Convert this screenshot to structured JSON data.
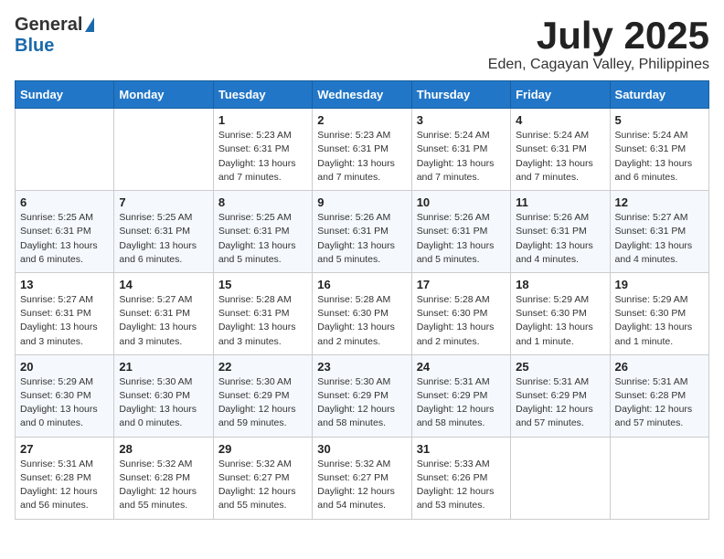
{
  "logo": {
    "general": "General",
    "blue": "Blue"
  },
  "title": "July 2025",
  "location": "Eden, Cagayan Valley, Philippines",
  "days_of_week": [
    "Sunday",
    "Monday",
    "Tuesday",
    "Wednesday",
    "Thursday",
    "Friday",
    "Saturday"
  ],
  "weeks": [
    [
      {
        "num": "",
        "content": ""
      },
      {
        "num": "",
        "content": ""
      },
      {
        "num": "1",
        "content": "Sunrise: 5:23 AM\nSunset: 6:31 PM\nDaylight: 13 hours and 7 minutes."
      },
      {
        "num": "2",
        "content": "Sunrise: 5:23 AM\nSunset: 6:31 PM\nDaylight: 13 hours and 7 minutes."
      },
      {
        "num": "3",
        "content": "Sunrise: 5:24 AM\nSunset: 6:31 PM\nDaylight: 13 hours and 7 minutes."
      },
      {
        "num": "4",
        "content": "Sunrise: 5:24 AM\nSunset: 6:31 PM\nDaylight: 13 hours and 7 minutes."
      },
      {
        "num": "5",
        "content": "Sunrise: 5:24 AM\nSunset: 6:31 PM\nDaylight: 13 hours and 6 minutes."
      }
    ],
    [
      {
        "num": "6",
        "content": "Sunrise: 5:25 AM\nSunset: 6:31 PM\nDaylight: 13 hours and 6 minutes."
      },
      {
        "num": "7",
        "content": "Sunrise: 5:25 AM\nSunset: 6:31 PM\nDaylight: 13 hours and 6 minutes."
      },
      {
        "num": "8",
        "content": "Sunrise: 5:25 AM\nSunset: 6:31 PM\nDaylight: 13 hours and 5 minutes."
      },
      {
        "num": "9",
        "content": "Sunrise: 5:26 AM\nSunset: 6:31 PM\nDaylight: 13 hours and 5 minutes."
      },
      {
        "num": "10",
        "content": "Sunrise: 5:26 AM\nSunset: 6:31 PM\nDaylight: 13 hours and 5 minutes."
      },
      {
        "num": "11",
        "content": "Sunrise: 5:26 AM\nSunset: 6:31 PM\nDaylight: 13 hours and 4 minutes."
      },
      {
        "num": "12",
        "content": "Sunrise: 5:27 AM\nSunset: 6:31 PM\nDaylight: 13 hours and 4 minutes."
      }
    ],
    [
      {
        "num": "13",
        "content": "Sunrise: 5:27 AM\nSunset: 6:31 PM\nDaylight: 13 hours and 3 minutes."
      },
      {
        "num": "14",
        "content": "Sunrise: 5:27 AM\nSunset: 6:31 PM\nDaylight: 13 hours and 3 minutes."
      },
      {
        "num": "15",
        "content": "Sunrise: 5:28 AM\nSunset: 6:31 PM\nDaylight: 13 hours and 3 minutes."
      },
      {
        "num": "16",
        "content": "Sunrise: 5:28 AM\nSunset: 6:30 PM\nDaylight: 13 hours and 2 minutes."
      },
      {
        "num": "17",
        "content": "Sunrise: 5:28 AM\nSunset: 6:30 PM\nDaylight: 13 hours and 2 minutes."
      },
      {
        "num": "18",
        "content": "Sunrise: 5:29 AM\nSunset: 6:30 PM\nDaylight: 13 hours and 1 minute."
      },
      {
        "num": "19",
        "content": "Sunrise: 5:29 AM\nSunset: 6:30 PM\nDaylight: 13 hours and 1 minute."
      }
    ],
    [
      {
        "num": "20",
        "content": "Sunrise: 5:29 AM\nSunset: 6:30 PM\nDaylight: 13 hours and 0 minutes."
      },
      {
        "num": "21",
        "content": "Sunrise: 5:30 AM\nSunset: 6:30 PM\nDaylight: 13 hours and 0 minutes."
      },
      {
        "num": "22",
        "content": "Sunrise: 5:30 AM\nSunset: 6:29 PM\nDaylight: 12 hours and 59 minutes."
      },
      {
        "num": "23",
        "content": "Sunrise: 5:30 AM\nSunset: 6:29 PM\nDaylight: 12 hours and 58 minutes."
      },
      {
        "num": "24",
        "content": "Sunrise: 5:31 AM\nSunset: 6:29 PM\nDaylight: 12 hours and 58 minutes."
      },
      {
        "num": "25",
        "content": "Sunrise: 5:31 AM\nSunset: 6:29 PM\nDaylight: 12 hours and 57 minutes."
      },
      {
        "num": "26",
        "content": "Sunrise: 5:31 AM\nSunset: 6:28 PM\nDaylight: 12 hours and 57 minutes."
      }
    ],
    [
      {
        "num": "27",
        "content": "Sunrise: 5:31 AM\nSunset: 6:28 PM\nDaylight: 12 hours and 56 minutes."
      },
      {
        "num": "28",
        "content": "Sunrise: 5:32 AM\nSunset: 6:28 PM\nDaylight: 12 hours and 55 minutes."
      },
      {
        "num": "29",
        "content": "Sunrise: 5:32 AM\nSunset: 6:27 PM\nDaylight: 12 hours and 55 minutes."
      },
      {
        "num": "30",
        "content": "Sunrise: 5:32 AM\nSunset: 6:27 PM\nDaylight: 12 hours and 54 minutes."
      },
      {
        "num": "31",
        "content": "Sunrise: 5:33 AM\nSunset: 6:26 PM\nDaylight: 12 hours and 53 minutes."
      },
      {
        "num": "",
        "content": ""
      },
      {
        "num": "",
        "content": ""
      }
    ]
  ]
}
